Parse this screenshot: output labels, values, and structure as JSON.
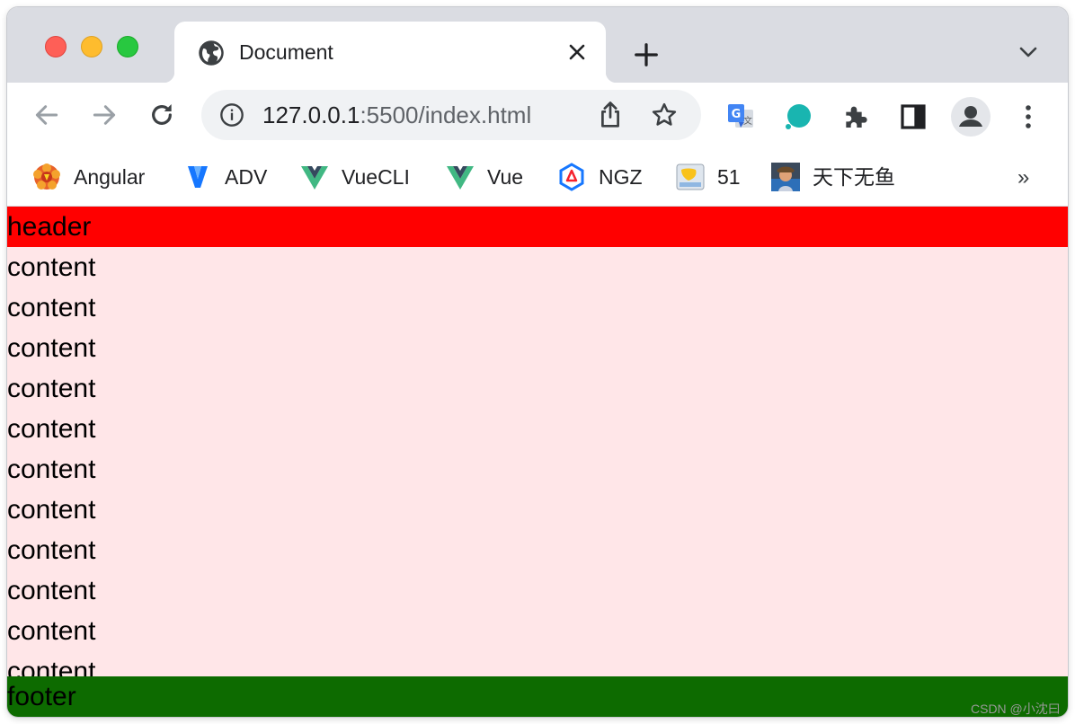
{
  "tab": {
    "title": "Document"
  },
  "toolbar": {
    "url_host": "127.0.0.1",
    "url_rest": ":5500/index.html"
  },
  "bookmarks": [
    {
      "label": "Angular",
      "icon": "angular-icon"
    },
    {
      "label": "ADV",
      "icon": "adv-icon"
    },
    {
      "label": "VueCLI",
      "icon": "vue-icon"
    },
    {
      "label": "Vue",
      "icon": "vue-icon"
    },
    {
      "label": "NGZ",
      "icon": "ngz-icon"
    },
    {
      "label": "51",
      "icon": "folder-icon"
    },
    {
      "label": "天下无鱼",
      "icon": "avatar-icon"
    }
  ],
  "bookmarks_more": "»",
  "page": {
    "header": "header",
    "content_lines": [
      "content",
      "content",
      "content",
      "content",
      "content",
      "content",
      "content",
      "content",
      "content",
      "content",
      "content"
    ],
    "footer": "footer"
  },
  "watermark": "CSDN @小沈曰",
  "colors": {
    "header_bg": "#ff0000",
    "content_bg": "#ffe6e8",
    "footer_bg": "#0d6b00",
    "tabstrip_bg": "#dadce2"
  }
}
